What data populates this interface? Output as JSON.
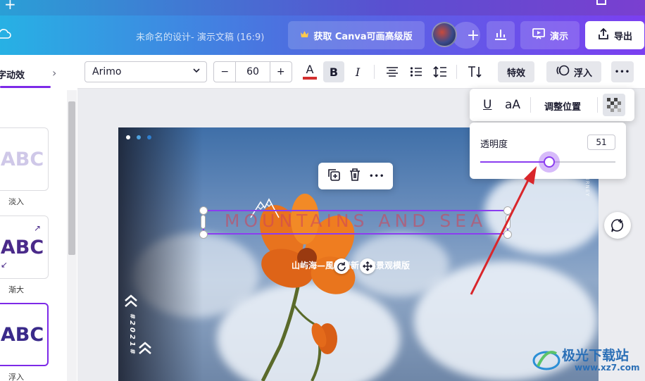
{
  "header": {
    "doc_title": "未命名的设计- 演示文稿 (16:9)",
    "upgrade_label": "获取 Canva可画高级版",
    "present_label": "演示",
    "export_label": "导出",
    "add_symbol": "+"
  },
  "left_panel": {
    "title": "字动效",
    "effects": [
      {
        "preview": "ABC",
        "label": "淡入"
      },
      {
        "preview": "ABC",
        "label": "渐大"
      },
      {
        "preview": "ABC",
        "label": "浮入"
      }
    ]
  },
  "toolbar": {
    "font": "Arimo",
    "minus": "−",
    "font_size": "60",
    "plus": "+",
    "text_color_glyph": "A",
    "bold_glyph": "B",
    "italic_glyph": "I",
    "effects_label": "特效",
    "float_label": "浮入",
    "more_glyph": "•••",
    "text_color": "#d32f2f"
  },
  "format_popover": {
    "underline_glyph": "U",
    "case_glyph": "aA",
    "position_label": "调整位置"
  },
  "transparency_popover": {
    "label": "透明度",
    "value": "51",
    "slider_fraction": 0.51
  },
  "slide": {
    "headline": "MOUNTAINS AND SEA",
    "subtitle": "山屿海—風格清新自然景观模版",
    "vertical_text": "#2021#",
    "side_text": "JOURNEY",
    "element_menu_more": "•••"
  },
  "watermark": {
    "brand": "极光下载站",
    "url": "www.xz7.com"
  },
  "colors": {
    "accent": "#7d2ae8",
    "arrow": "#d9262b"
  }
}
